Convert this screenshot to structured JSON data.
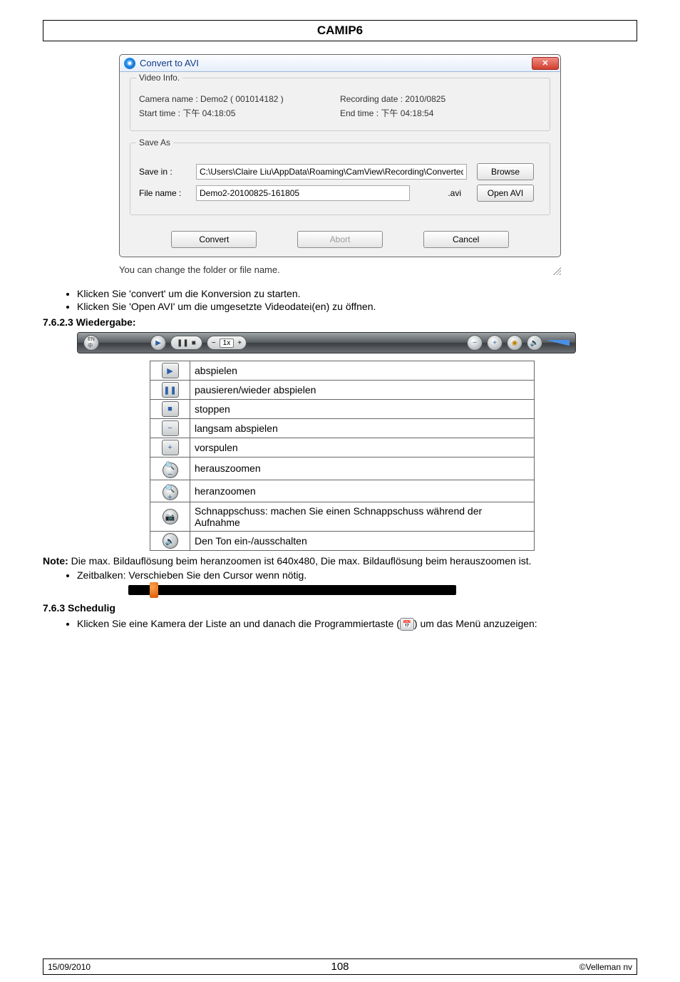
{
  "header": {
    "title": "CAMIP6"
  },
  "dialog": {
    "title": "Convert to AVI",
    "close_glyph": "✕",
    "video_info": {
      "legend": "Video Info.",
      "camera_label": "Camera name : Demo2 ( 001014182 )",
      "recdate_label": "Recording date : 2010/0825",
      "start_label": "Start time : 下午 04:18:05",
      "end_label": "End time : 下午 04:18:54"
    },
    "save_as": {
      "legend": "Save As",
      "savein_label": "Save in :",
      "savein_value": "C:\\Users\\Claire Liu\\AppData\\Roaming\\CamView\\Recording\\Converted",
      "browse_label": "Browse",
      "filename_label": "File name :",
      "filename_value": "Demo2-20100825-161805",
      "ext": ".avi",
      "openavi_label": "Open AVI"
    },
    "buttons": {
      "convert": "Convert",
      "abort": "Abort",
      "cancel": "Cancel"
    },
    "status": "You can change the folder or file name."
  },
  "instructions": {
    "b1": "Klicken Sie 'convert' um die Konversion zu starten.",
    "b2": "Klicken Sie 'Open AVI' um die umgesetzte Videodatei(en) zu öffnen."
  },
  "playback": {
    "heading": "7.6.2.3 Wiedergabe:",
    "rows": [
      {
        "icon_name": "play-icon",
        "glyph": "▶",
        "desc": "abspielen"
      },
      {
        "icon_name": "pause-icon",
        "glyph": "❚❚",
        "desc": "pausieren/wieder abspielen"
      },
      {
        "icon_name": "stop-icon",
        "glyph": "■",
        "desc": "stoppen"
      },
      {
        "icon_name": "slow-icon",
        "glyph": "−",
        "desc": "langsam abspielen"
      },
      {
        "icon_name": "fast-icon",
        "glyph": "+",
        "desc": "vorspulen"
      },
      {
        "icon_name": "zoom-out-icon",
        "glyph": "🔍−",
        "desc": "herauszoomen"
      },
      {
        "icon_name": "zoom-in-icon",
        "glyph": "🔍+",
        "desc": "heranzoomen"
      },
      {
        "icon_name": "snapshot-icon",
        "glyph": "📷",
        "desc": "Schnappschuss: machen Sie einen Schnappschuss während der Aufnahme"
      },
      {
        "icon_name": "mute-icon",
        "glyph": "🔊",
        "desc": "Den Ton ein-/ausschalten"
      }
    ],
    "toolbar_speed": "1x"
  },
  "note": {
    "label": "Note:",
    "text": " Die max. Bildauflösung beim heranzoomen ist 640x480, Die max. Bildauflösung beim herauszoomen ist."
  },
  "timebar_bullet": "Zeitbalken: Verschieben Sie den Cursor wenn nötig.",
  "scheduling": {
    "heading": "7.6.3 Schedulig",
    "bullet_pre": "Klicken Sie eine Kamera der Liste an und danach die Programmiertaste (",
    "bullet_post": ") um das Menü anzuzeigen:"
  },
  "footer": {
    "date": "15/09/2010",
    "page": "108",
    "copyright": "©Velleman nv"
  }
}
